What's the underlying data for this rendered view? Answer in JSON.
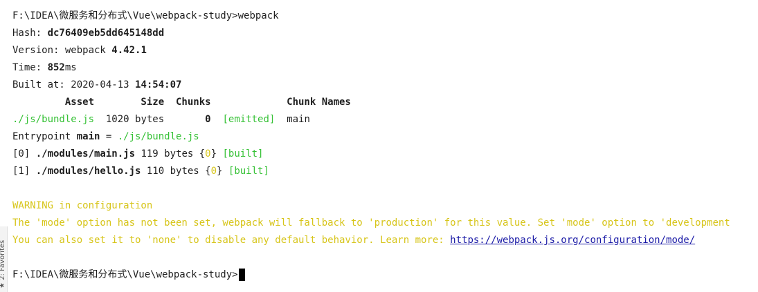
{
  "terminal": {
    "prompt_path": "F:\\IDEA\\微服务和分布式\\Vue\\webpack-study",
    "prompt_symbol": ">",
    "command": "webpack",
    "hash_label": "Hash: ",
    "hash_value": "dc76409eb5dd645148dd",
    "version_label": "Version: webpack ",
    "version_value": "4.42.1",
    "time_label": "Time: ",
    "time_value": "852",
    "time_unit": "ms",
    "built_label": "Built at: 2020-04-13 ",
    "built_time": "14:54:07",
    "table_header": "         Asset        Size  Chunks             Chunk Names",
    "asset_name": "./js/bundle.js",
    "asset_size": "  1020 bytes       ",
    "asset_chunk": "0",
    "asset_status": "[emitted]",
    "asset_chunk_name": "main",
    "entry_prefix": "Entrypoint ",
    "entry_name": "main",
    "entry_eq": " = ",
    "entry_file": "./js/bundle.js",
    "module0_id": "[0] ",
    "module0_path": "./modules/main.js",
    "module0_size": " 119 bytes {",
    "module0_chunk": "0",
    "module0_close": "} ",
    "module0_status": "[built]",
    "module1_id": "[1] ",
    "module1_path": "./modules/hello.js",
    "module1_size": " 110 bytes {",
    "module1_chunk": "0",
    "module1_close": "} ",
    "module1_status": "[built]",
    "warning_title": "WARNING in configuration",
    "warning_line1": "The 'mode' option has not been set, webpack will fallback to 'production' for this value. Set 'mode' option to 'development",
    "warning_line2": "You can also set it to 'none' to disable any default behavior. Learn more: ",
    "warning_link": "https://webpack.js.org/configuration/mode/",
    "final_prompt": "F:\\IDEA\\微服务和分布式\\Vue\\webpack-study>"
  },
  "sidebar": {
    "favorites_label": "2: Favorites",
    "favorites_icon": "star-icon"
  },
  "colors": {
    "green": "#35c135",
    "yellow": "#d7c51a",
    "link": "#1a1aa6"
  }
}
